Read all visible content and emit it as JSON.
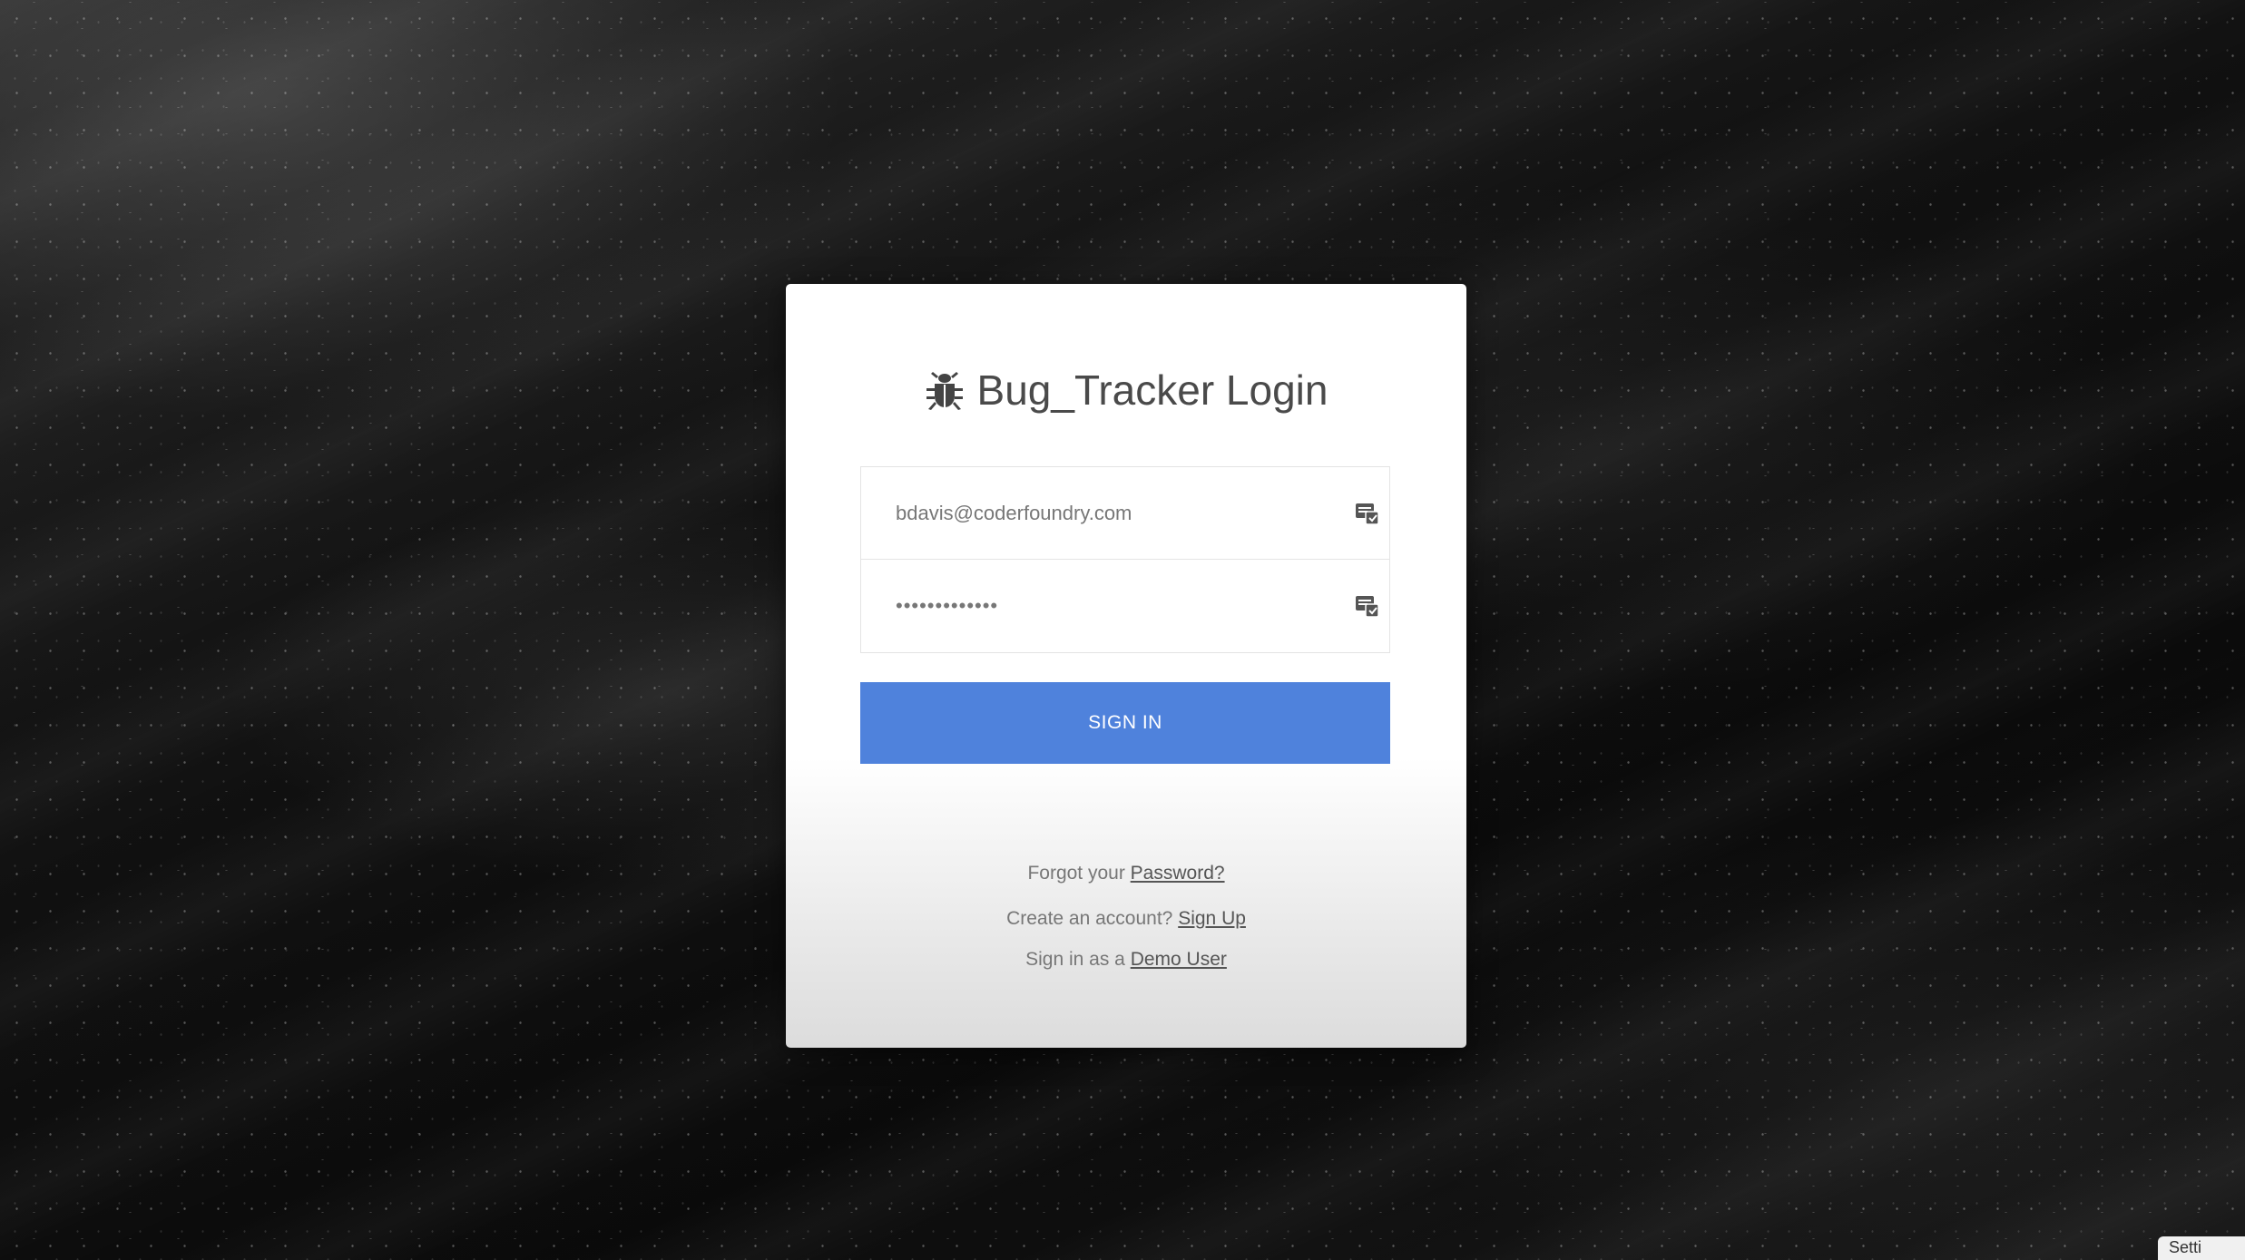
{
  "login": {
    "title": "Bug_Tracker Login",
    "email_value": "bdavis@coderfoundry.com",
    "password_value": "•••••••••••••",
    "signin_label": "SIGN IN",
    "forgot_prefix": "Forgot your",
    "forgot_link": "Password?",
    "create_prefix": "Create an account?",
    "create_link": "Sign Up",
    "demo_prefix": "Sign in as a",
    "demo_link": "Demo User"
  },
  "icons": {
    "title_icon": "bug-icon",
    "field_icon": "autofill-icon"
  },
  "colors": {
    "primary_button": "#4f82dc",
    "card_background": "#ffffff",
    "page_background": "#121212"
  },
  "corner_badge": {
    "text": "Setti"
  }
}
